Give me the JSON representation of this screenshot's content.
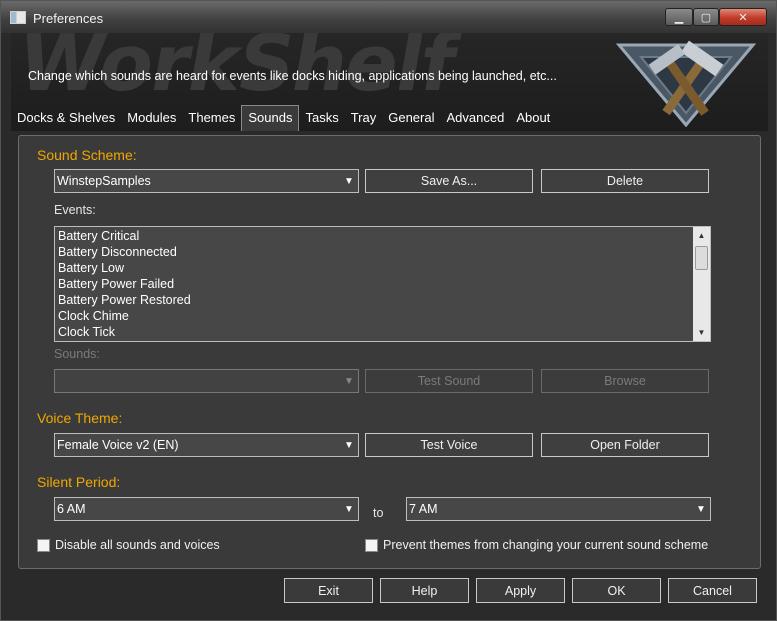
{
  "window": {
    "title": "Preferences"
  },
  "titlebar": {
    "minimize": "▁",
    "maximize": "▢",
    "close": "✕"
  },
  "header": {
    "watermark": "WorkShelf",
    "description": "Change which sounds are heard for events like docks hiding, applications being launched, etc..."
  },
  "tabs": [
    {
      "label": "Docks & Shelves"
    },
    {
      "label": "Modules"
    },
    {
      "label": "Themes"
    },
    {
      "label": "Sounds",
      "active": true
    },
    {
      "label": "Tasks"
    },
    {
      "label": "Tray"
    },
    {
      "label": "General"
    },
    {
      "label": "Advanced"
    },
    {
      "label": "About"
    }
  ],
  "sound_scheme": {
    "heading": "Sound Scheme:",
    "selected": "WinstepSamples",
    "save_as": "Save As...",
    "delete": "Delete"
  },
  "events": {
    "label": "Events:",
    "items": [
      "Battery Critical",
      "Battery Disconnected",
      "Battery Low",
      "Battery Power Failed",
      "Battery Power Restored",
      "Clock Chime",
      "Clock Tick"
    ]
  },
  "sounds": {
    "label": "Sounds:",
    "selected": "",
    "test_sound": "Test Sound",
    "browse": "Browse"
  },
  "voice_theme": {
    "heading": "Voice Theme:",
    "selected": "Female Voice v2 (EN)",
    "test_voice": "Test Voice",
    "open_folder": "Open Folder"
  },
  "silent_period": {
    "heading": "Silent Period:",
    "from": "6 AM",
    "to_label": "to",
    "to": "7 AM"
  },
  "options": {
    "disable_all": "Disable all sounds and voices",
    "prevent_themes": "Prevent themes from changing your current sound scheme"
  },
  "footer": {
    "exit": "Exit",
    "help": "Help",
    "apply": "Apply",
    "ok": "OK",
    "cancel": "Cancel"
  },
  "colors": {
    "accent_heading": "#f0a800",
    "panel_bg": "#3a3a3a",
    "close_button": "#c13b2a"
  }
}
